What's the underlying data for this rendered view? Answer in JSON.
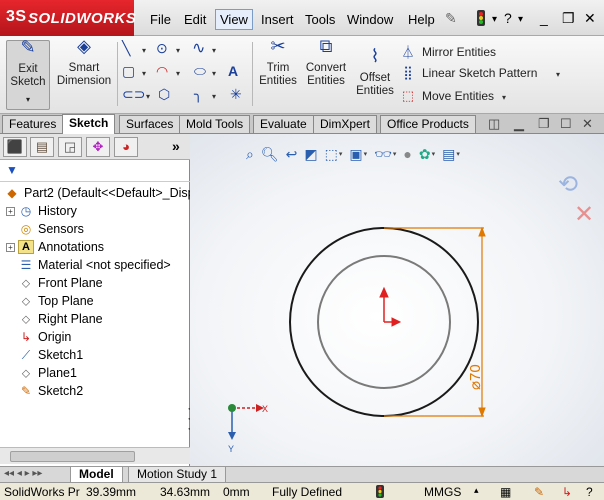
{
  "app": {
    "logo_mark": "3S",
    "logo_text": "SOLIDWORKS"
  },
  "menu": {
    "items": [
      "File",
      "Edit",
      "View",
      "Insert",
      "Tools",
      "Window",
      "Help"
    ],
    "active": "View",
    "help_icon": "?"
  },
  "command_manager": {
    "exit_sketch": [
      "Exit",
      "Sketch"
    ],
    "smart_dimension": [
      "Smart",
      "Dimension"
    ],
    "trim_entities": [
      "Trim",
      "Entities"
    ],
    "convert_entities": [
      "Convert",
      "Entities"
    ],
    "offset_entities": [
      "Offset",
      "Entities"
    ],
    "mirror_entities": "Mirror Entities",
    "linear_pattern": "Linear Sketch Pattern",
    "move_entities": "Move Entities"
  },
  "tabs": {
    "items": [
      "Features",
      "Sketch",
      "Surfaces",
      "Mold Tools",
      "Evaluate",
      "DimXpert",
      "Office Products"
    ],
    "active": "Sketch"
  },
  "feature_tree": {
    "root": "Part2  (Default<<Default>_Disp",
    "items": [
      {
        "label": "History",
        "icon": "history-icon",
        "expandable": true
      },
      {
        "label": "Sensors",
        "icon": "sensor-icon",
        "expandable": false
      },
      {
        "label": "Annotations",
        "icon": "annotations-icon",
        "expandable": true
      },
      {
        "label": "Material <not specified>",
        "icon": "material-icon",
        "expandable": false
      },
      {
        "label": "Front Plane",
        "icon": "plane-icon",
        "expandable": false
      },
      {
        "label": "Top Plane",
        "icon": "plane-icon",
        "expandable": false
      },
      {
        "label": "Right Plane",
        "icon": "plane-icon",
        "expandable": false
      },
      {
        "label": "Origin",
        "icon": "origin-icon",
        "expandable": false
      },
      {
        "label": "Sketch1",
        "icon": "sketch-icon",
        "expandable": false
      },
      {
        "label": "Plane1",
        "icon": "plane-icon",
        "expandable": false
      },
      {
        "label": "Sketch2",
        "icon": "sketch-edit-icon",
        "expandable": false
      }
    ]
  },
  "graphics": {
    "dimension_text": "⌀70",
    "axis_x_label": "X",
    "axis_y_label": "Y",
    "colors": {
      "circle": "#1a1a1a",
      "inner_circle": "#7a7a7a",
      "dimension": "#e07800",
      "origin_arrow": "#e02020",
      "axis": "#cc2020"
    }
  },
  "bottom_tabs": {
    "items": [
      "Model",
      "Motion Study 1"
    ],
    "active": "Model"
  },
  "status": {
    "app": "SolidWorks Pr",
    "x": "39.39mm",
    "y": "34.63mm",
    "z": "0mm",
    "state": "Fully Defined",
    "units": "MMGS"
  }
}
